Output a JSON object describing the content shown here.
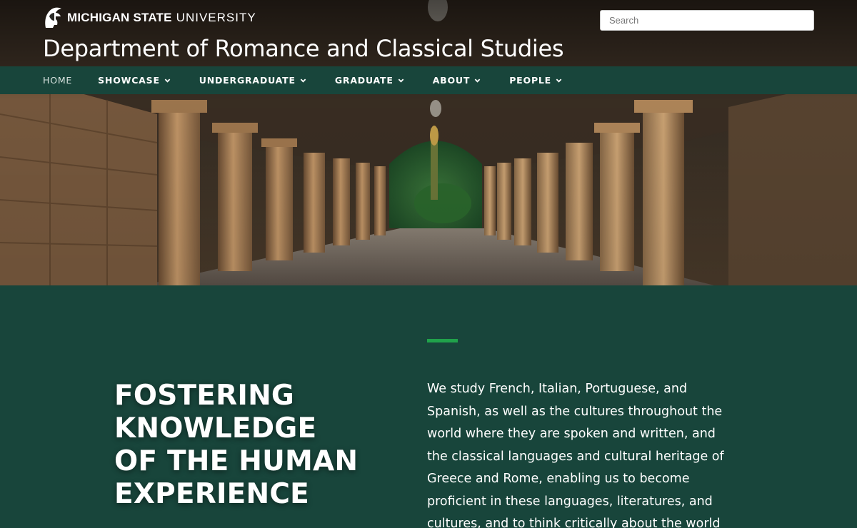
{
  "header": {
    "university_bold": "MICHIGAN STATE",
    "university_light": "UNIVERSITY",
    "site_title": "Department of Romance and Classical Studies",
    "search_placeholder": "Search"
  },
  "nav": {
    "items": [
      {
        "label": "HOME",
        "dropdown": false
      },
      {
        "label": "SHOWCASE",
        "dropdown": true
      },
      {
        "label": "UNDERGRADUATE",
        "dropdown": true
      },
      {
        "label": "GRADUATE",
        "dropdown": true
      },
      {
        "label": "ABOUT",
        "dropdown": true
      },
      {
        "label": "PEOPLE",
        "dropdown": true
      }
    ]
  },
  "hero": {
    "image_subject": "stone arcade with columns and arches"
  },
  "main": {
    "headline_lines": [
      "FOSTERING",
      "KNOWLEDGE",
      "OF THE HUMAN",
      "EXPERIENCE"
    ],
    "intro_text": "We study French, Italian, Portuguese, and Spanish, as well as the cultures throughout the world where they are spoken and written, and the classical languages and cultural heritage of Greece and Rome, enabling us to become proficient in these languages, literatures, and cultures, and to think critically about the world"
  },
  "colors": {
    "msu_green": "#18453b",
    "accent_green": "#20a24b",
    "white": "#ffffff"
  }
}
